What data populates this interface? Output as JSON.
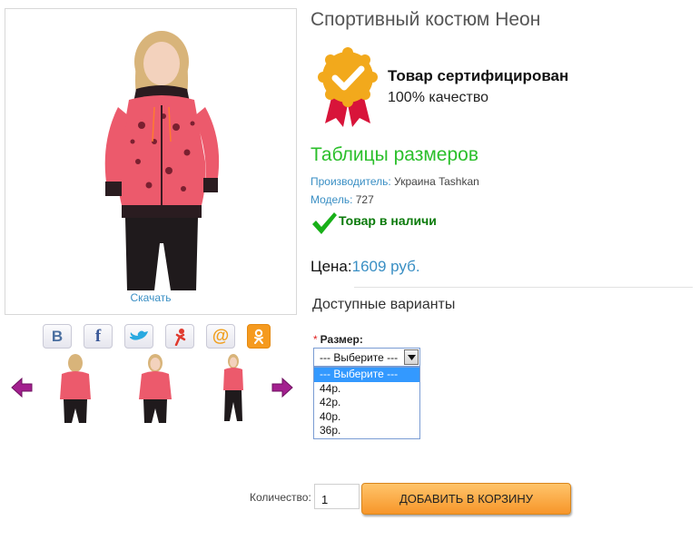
{
  "product": {
    "title": "Спортивный костюм Неон",
    "download_label": "Скачать"
  },
  "certificate": {
    "title": "Товар сертифицирован",
    "subtitle": "100% качество"
  },
  "size_table_link": "Таблицы размеров",
  "meta": {
    "manufacturer_key": "Производитель:",
    "manufacturer_value": "Украина Tashkan",
    "model_key": "Модель:",
    "model_value": "727"
  },
  "stock_status": "Товар в наличи",
  "price": {
    "label": "Цена:",
    "value": "1609 руб."
  },
  "options": {
    "title": "Доступные варианты",
    "size_required_mark": "*",
    "size_label": "Размер:",
    "select_value": "--- Выберите ---",
    "dropdown_options": [
      "--- Выберите ---",
      "44р.",
      "42р.",
      "40р.",
      "36р."
    ]
  },
  "social_icons": [
    "vk-icon",
    "facebook-icon",
    "twitter-icon",
    "odnoklassniki-person-icon",
    "mail-at-icon",
    "ok-icon"
  ],
  "social_letters": {
    "vk": "B",
    "facebook": "f",
    "mail": "@"
  },
  "quantity": {
    "label": "Количество:",
    "value": "1"
  },
  "cart_button": "ДОБАВИТЬ В КОРЗИНУ",
  "colors": {
    "accent_link": "#3a8fc4",
    "size_table": "#2bbf2b",
    "in_stock": "#0a7a0a",
    "cart_button": "#f7962a",
    "selected_option": "#3399ff"
  }
}
